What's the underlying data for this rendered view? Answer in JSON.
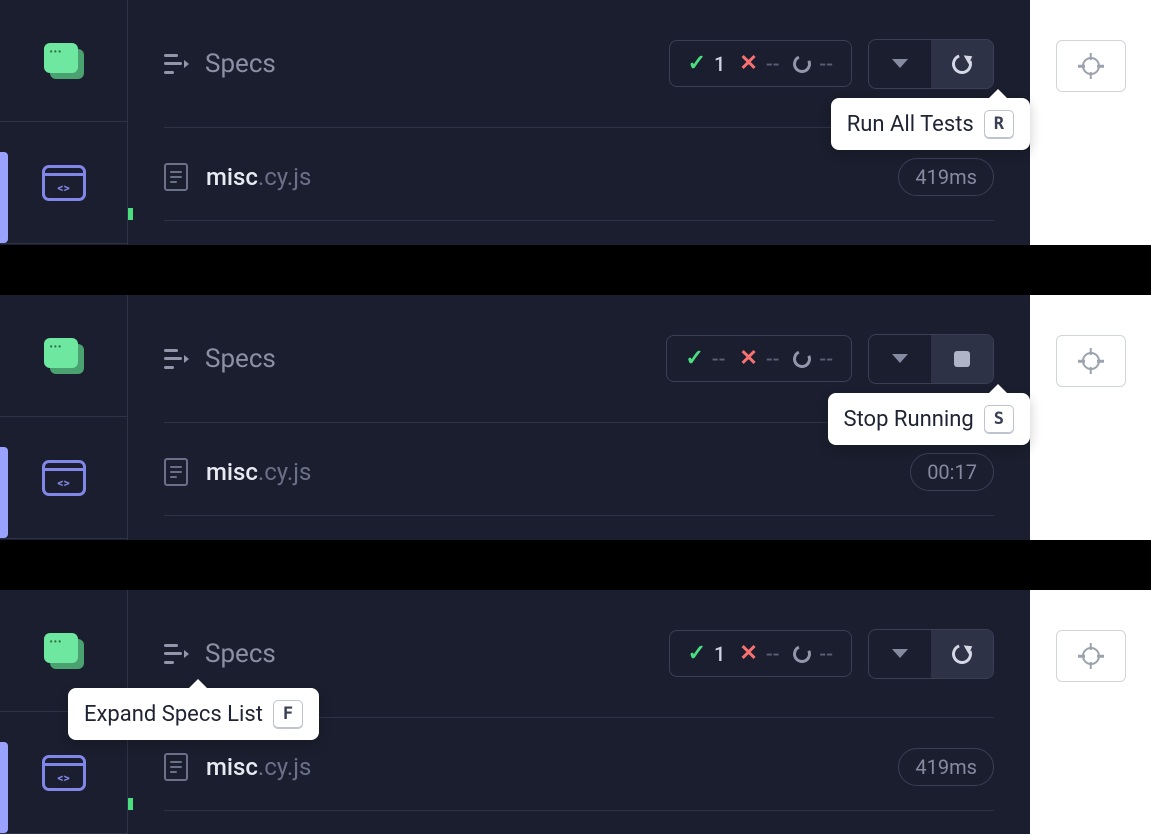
{
  "panels": [
    {
      "specs_label": "Specs",
      "stats": {
        "passed": "1",
        "failed": "--",
        "pending": "--"
      },
      "spec": {
        "name": "misc",
        "ext": ".cy.js",
        "duration": "419ms"
      },
      "tooltip": {
        "text": "Run All Tests",
        "key": "R"
      },
      "control_mode": "reload"
    },
    {
      "specs_label": "Specs",
      "stats": {
        "passed": "--",
        "failed": "--",
        "pending": "--"
      },
      "spec": {
        "name": "misc",
        "ext": ".cy.js",
        "duration": "00:17"
      },
      "tooltip": {
        "text": "Stop Running",
        "key": "S"
      },
      "control_mode": "stop"
    },
    {
      "specs_label": "Specs",
      "stats": {
        "passed": "1",
        "failed": "--",
        "pending": "--"
      },
      "spec": {
        "name": "misc",
        "ext": ".cy.js",
        "duration": "419ms"
      },
      "tooltip": {
        "text": "Expand Specs List",
        "key": "F"
      },
      "control_mode": "reload"
    }
  ]
}
